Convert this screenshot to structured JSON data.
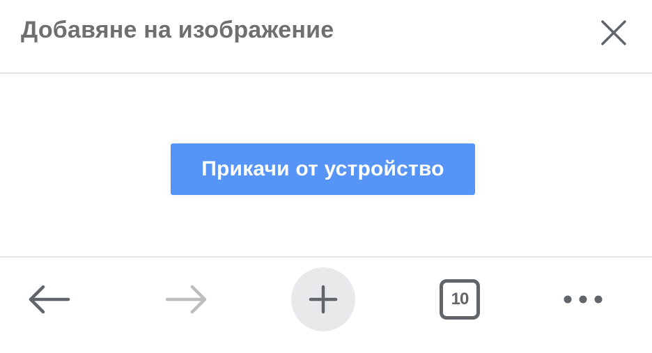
{
  "dialog": {
    "title": "Добавяне на изображение",
    "close_icon": "close-icon"
  },
  "content": {
    "upload_button_label": "Прикачи от устройство"
  },
  "toolbar": {
    "back_icon": "back-arrow-icon",
    "forward_icon": "forward-arrow-icon",
    "new_tab_icon": "plus-icon",
    "tab_count": "10",
    "menu_icon": "more-dots-icon"
  },
  "colors": {
    "accent": "#5694f7",
    "icon": "#616469",
    "icon_disabled": "#bdbdbd",
    "title": "#6f6f6f"
  }
}
